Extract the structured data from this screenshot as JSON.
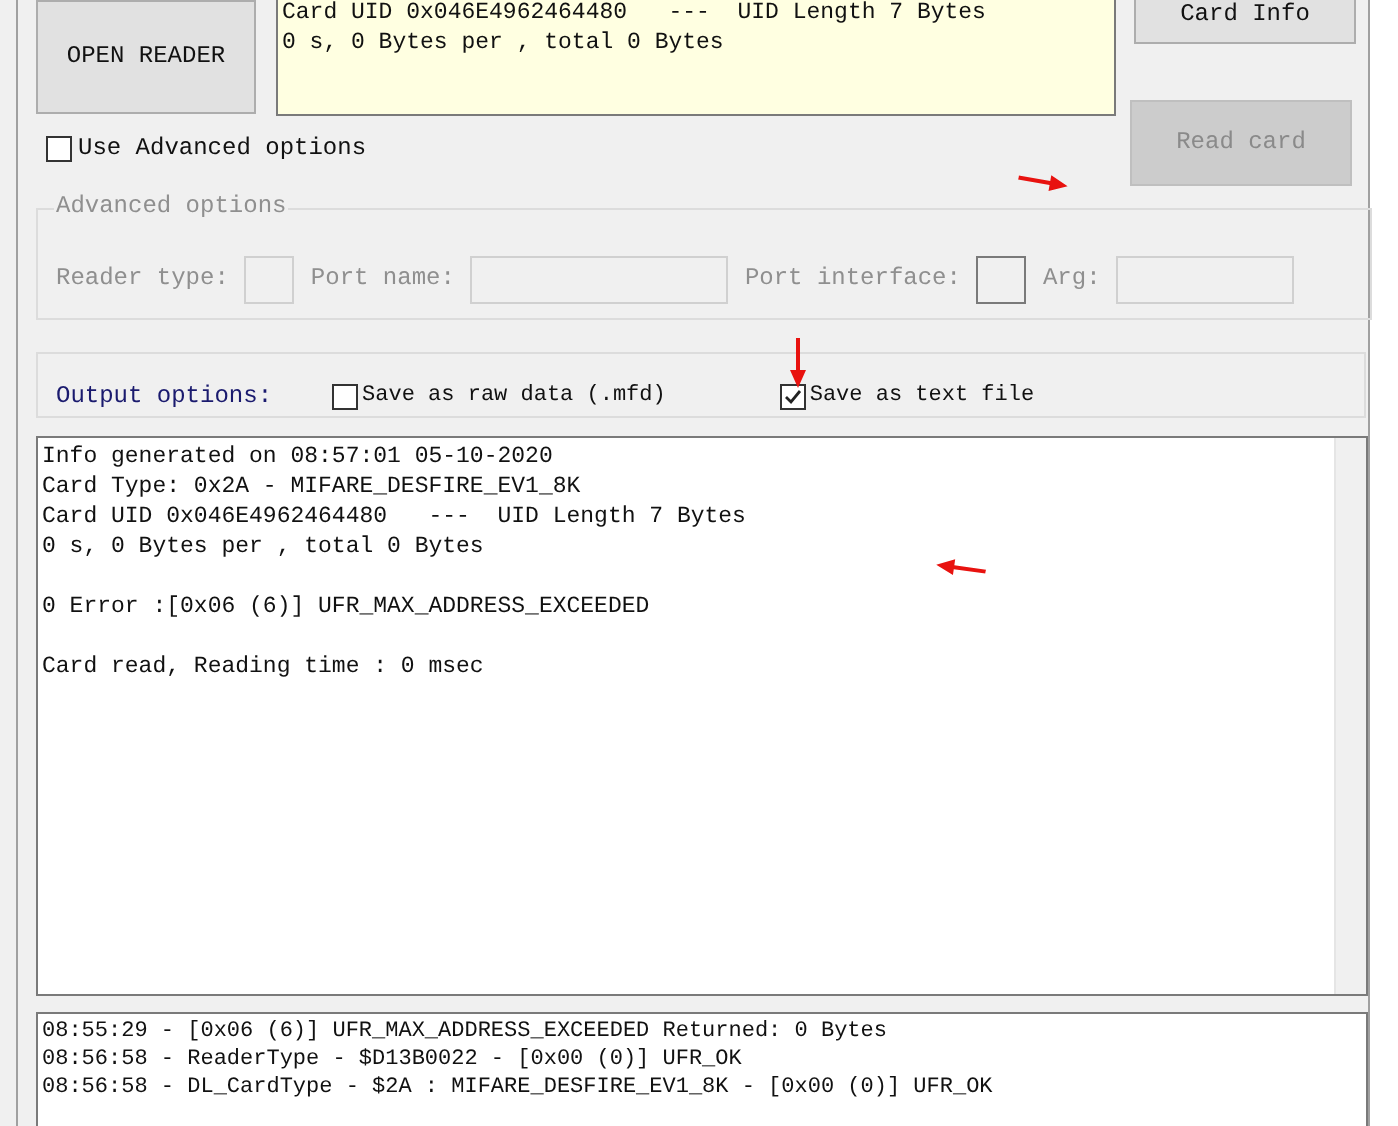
{
  "buttons": {
    "open_reader": {
      "label": "OPEN READER"
    },
    "card_info": {
      "label": "Card Info"
    },
    "read_card": {
      "label": "Read card",
      "disabled": true
    }
  },
  "summary_box": {
    "lines": [
      "Card UID 0x046E4962464480   ---  UID Length 7 Bytes",
      "0 s, 0 Bytes per , total 0 Bytes"
    ]
  },
  "use_advanced": {
    "label": "Use Advanced options",
    "checked": false
  },
  "advanced_options": {
    "title": "Advanced options",
    "fields": [
      {
        "label": "Reader type:"
      },
      {
        "label": "Port name:"
      },
      {
        "label": "Port interface:"
      },
      {
        "label": "Arg:"
      }
    ]
  },
  "output_options": {
    "label": "Output options:",
    "checkboxes": [
      {
        "label": "Save as raw data (.mfd)",
        "checked": false
      },
      {
        "label": "Save as text file",
        "checked": true
      }
    ]
  },
  "output_text": {
    "paragraphs": [
      [
        "Info generated on 08:57:01 05-10-2020",
        "Card Type: 0x2A - MIFARE_DESFIRE_EV1_8K",
        "Card UID 0x046E4962464480   ---  UID Length 7 Bytes",
        "0 s, 0 Bytes per , total 0 Bytes"
      ],
      [
        "0 Error :[0x06 (6)] UFR_MAX_ADDRESS_EXCEEDED"
      ],
      [
        "Card read, Reading time : 0 msec"
      ]
    ]
  },
  "log": {
    "lines": [
      "08:55:29 - [0x06 (6)] UFR_MAX_ADDRESS_EXCEEDED Returned: 0 Bytes",
      "08:56:58 - ReaderType - $D13B0022 - [0x00 (0)] UFR_OK",
      "08:56:58 - DL_CardType - $2A : MIFARE_DESFIRE_EV1_8K - [0x00 (0)] UFR_OK"
    ]
  }
}
